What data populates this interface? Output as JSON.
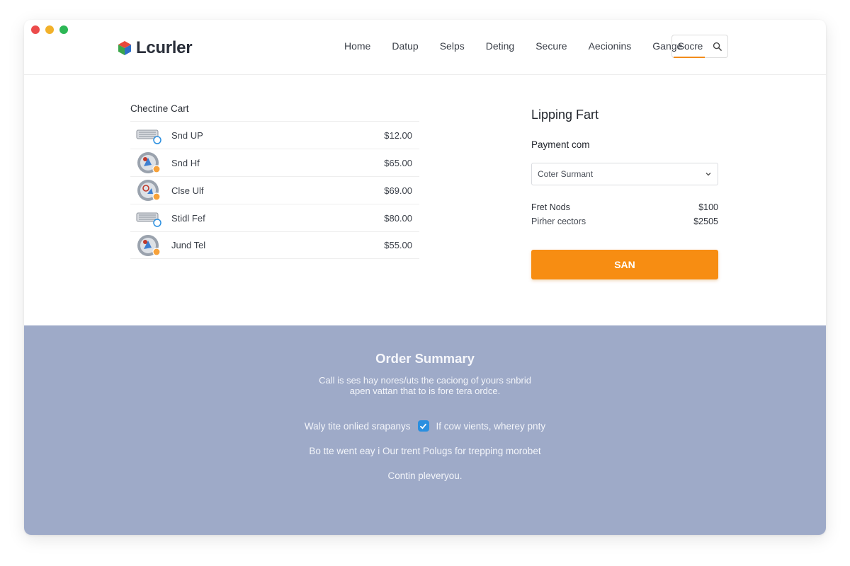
{
  "nav": {
    "logo": "Lcurler",
    "links": [
      "Home",
      "Datup",
      "Selps",
      "Deting",
      "Secure",
      "Aecionins",
      "Gange"
    ],
    "search_label": "Socre"
  },
  "cart": {
    "title": "Chectine Cart",
    "items": [
      {
        "name": "Snd UP",
        "price": "$12.00",
        "icon": "tray-icon"
      },
      {
        "name": "Snd Hf",
        "price": "$65.00",
        "icon": "round-product-icon"
      },
      {
        "name": "Clse Ulf",
        "price": "$69.00",
        "icon": "round-product-icon"
      },
      {
        "name": "Stidl Fef",
        "price": "$80.00",
        "icon": "tray-icon"
      },
      {
        "name": "Jund Tel",
        "price": "$55.00",
        "icon": "round-product-icon"
      }
    ]
  },
  "side": {
    "title": "Lipping Fart",
    "payment_label": "Payment com",
    "payment_select": "Coter Surmant",
    "lines": [
      {
        "label": "Fret Nods",
        "value": "$100"
      },
      {
        "label": "Pirher cectors",
        "value": "$2505"
      }
    ],
    "button": "SAN"
  },
  "footer": {
    "title": "Order Summary",
    "desc_line1": "Call is ses hay nores/uts the caciong of yours snbrid",
    "desc_line2": "apen vattan that to is fore tera ordce.",
    "check_left": "Waly tite onlied srapanys",
    "check_right": "If cow vients, wherey pnty",
    "line2": "Bo tte went eay i Our trent Polugs for trepping morobet",
    "line3": "Contin pleveryou."
  },
  "colors": {
    "accent": "#f78d12",
    "footer_bg": "#9eaac8",
    "checkbox": "#2a8fe0"
  }
}
